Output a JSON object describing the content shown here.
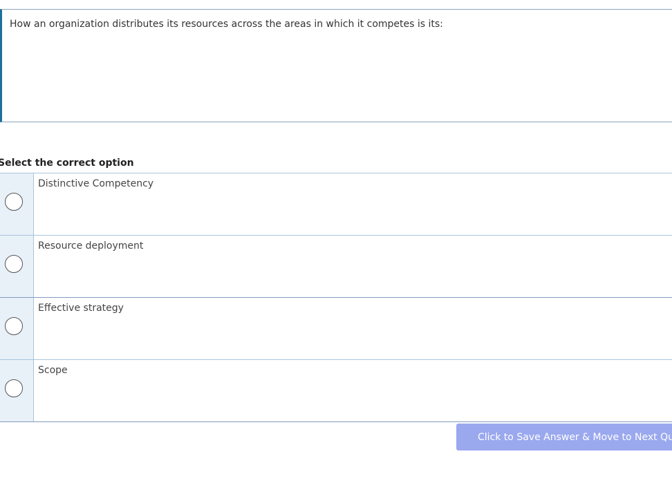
{
  "question": {
    "text": "How an organization distributes its resources across the areas in which it competes is its:"
  },
  "options_section": {
    "label": "Select the correct option",
    "options": [
      {
        "label": "Distinctive Competency",
        "selected": false
      },
      {
        "label": "Resource deployment",
        "selected": false
      },
      {
        "label": "Effective strategy",
        "selected": false
      },
      {
        "label": "Scope",
        "selected": false
      }
    ]
  },
  "actions": {
    "next_label": "Click to Save Answer & Move to Next Question"
  },
  "colors": {
    "accent_border": "#1f6f9c",
    "radio_cell_bg": "#e8f0f8",
    "button_bg": "#9aa8ee"
  }
}
